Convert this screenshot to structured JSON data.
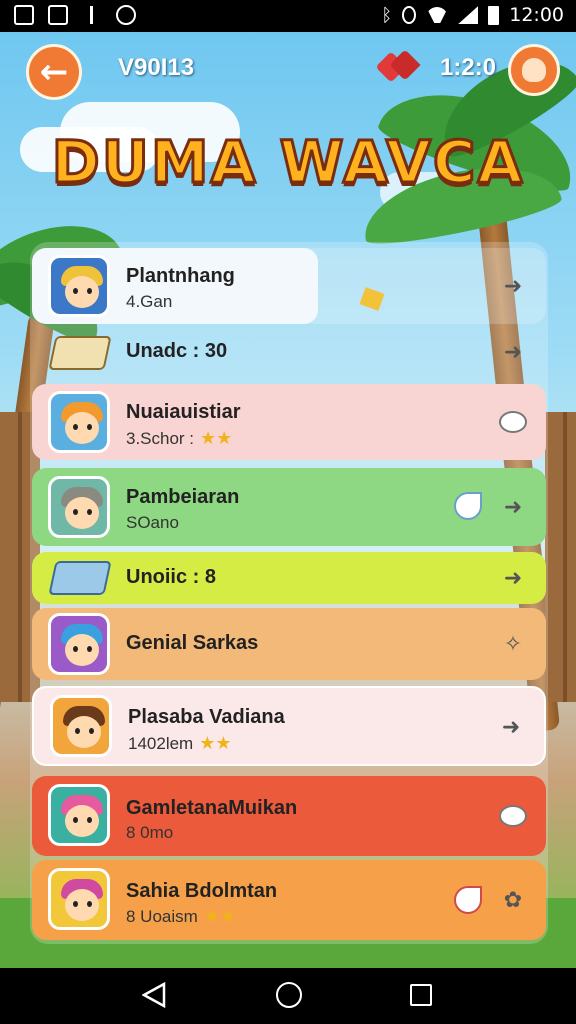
{
  "status_bar": {
    "time": "12:00"
  },
  "header": {
    "version": "V90I13",
    "timer": "1:2:0",
    "title": "DUMA WAVCA"
  },
  "rows": [
    {
      "title": "Plantnhang",
      "subtitle": "4.Gan",
      "color": "#f2f8fb",
      "type": "player"
    },
    {
      "label": "Unadc :",
      "value": "30",
      "type": "item"
    },
    {
      "title": "Nuaiauistiar",
      "subtitle": "3.Schor :",
      "color": "#f8d4d2",
      "type": "player"
    },
    {
      "title": "Pambeiaran",
      "subtitle": "SOano",
      "color": "#8fd883",
      "type": "player"
    },
    {
      "label": "Unoiic :",
      "value": "8",
      "type": "item"
    },
    {
      "title": "Genial Sarkas",
      "subtitle": "",
      "color": "#f2b979",
      "type": "player"
    },
    {
      "title": "Plasaba Vadiana",
      "subtitle": "1402lem",
      "color": "#fbe9ea",
      "type": "player"
    },
    {
      "title": "GamletanaMuikan",
      "subtitle": "8 0mo",
      "color": "#ec5a3c",
      "type": "player"
    },
    {
      "title": "Sahia Bdolmtan",
      "subtitle": "8 Uoaism",
      "color": "#f6a14a",
      "type": "player"
    }
  ],
  "icons": [
    "back-arrow-icon",
    "hearts-icon",
    "profile-icon",
    "arrow-right-icon",
    "chat-bubble-icon",
    "leaf-icon",
    "trophy-icon"
  ]
}
